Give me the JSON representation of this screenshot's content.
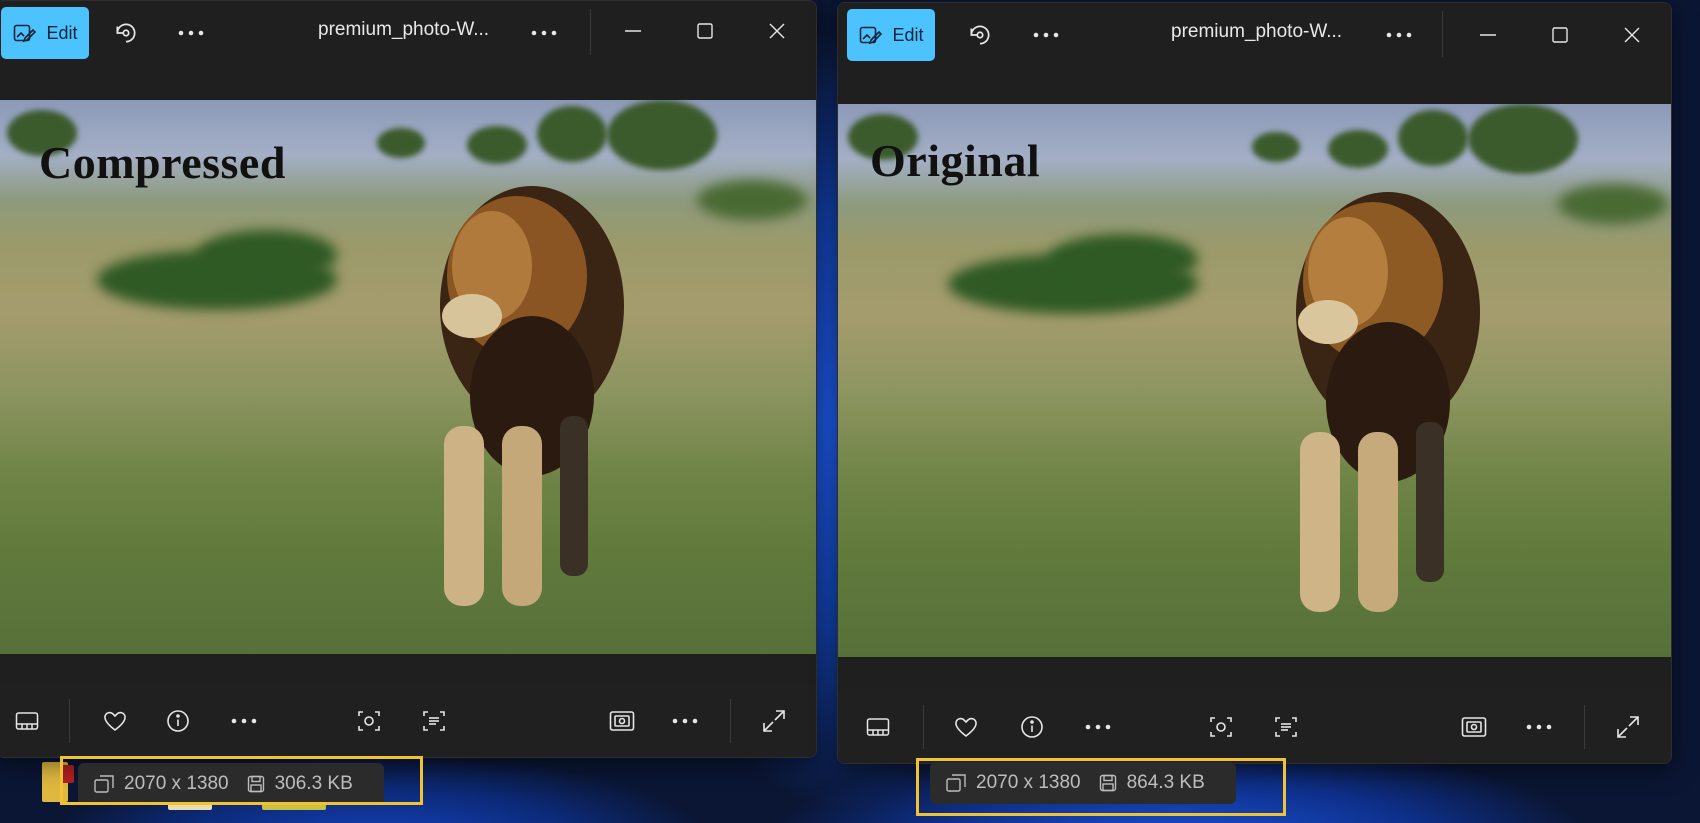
{
  "windows": [
    {
      "edit_label": "Edit",
      "title": "premium_photo-W...",
      "photo_label": "Compressed",
      "info": {
        "dimensions": "2070 x 1380",
        "size": "306.3 KB"
      }
    },
    {
      "edit_label": "Edit",
      "title": "premium_photo-W...",
      "photo_label": "Original",
      "info": {
        "dimensions": "2070 x 1380",
        "size": "864.3 KB"
      }
    }
  ],
  "icons": {
    "edit": "edit-photo-icon",
    "rotate": "rotate-icon",
    "more": "more-icon",
    "minimize": "minimize-icon",
    "maximize": "maximize-icon",
    "close": "close-icon",
    "filmstrip": "filmstrip-icon",
    "favorite": "heart-icon",
    "info": "info-icon",
    "visual_search": "visual-search-icon",
    "text": "text-extract-icon",
    "slideshow": "slideshow-icon",
    "fullscreen": "fullscreen-icon",
    "dimensions": "dimensions-icon",
    "disk": "disk-icon"
  },
  "colors": {
    "accent": "#4cc2ff",
    "highlight": "#f1c232",
    "window_bg": "#1f1f1f"
  }
}
